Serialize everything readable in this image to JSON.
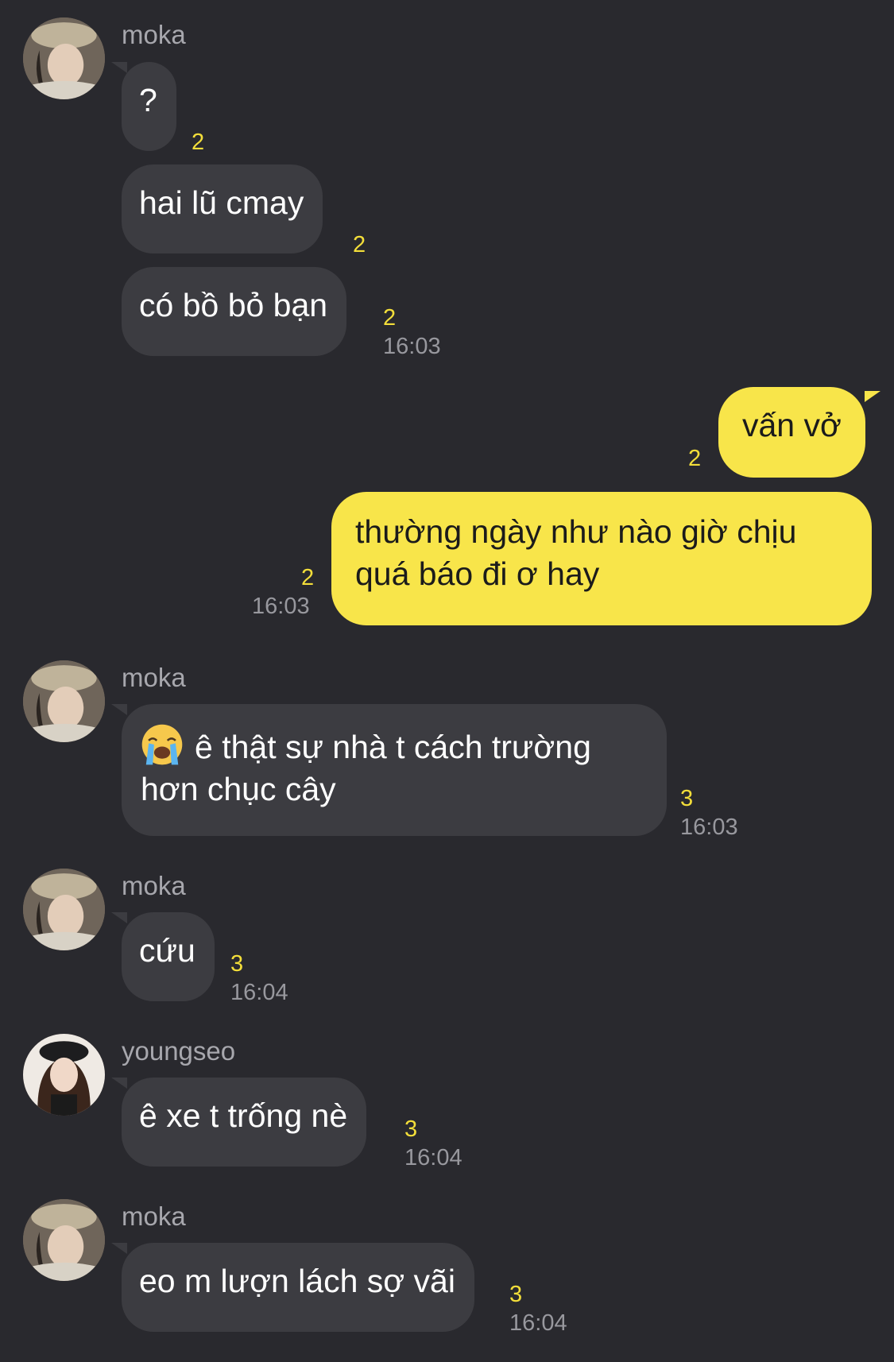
{
  "senders": {
    "moka": "moka",
    "youngseo": "youngseo"
  },
  "messages": [
    {
      "id": "m1",
      "text": "?",
      "read_count": "2"
    },
    {
      "id": "m2",
      "text": "hai lũ cmay",
      "read_count": "2"
    },
    {
      "id": "m3",
      "text": "có bồ bỏ bạn",
      "read_count": "2",
      "time": "16:03"
    },
    {
      "id": "m4",
      "text": "vấn vở",
      "read_count": "2"
    },
    {
      "id": "m5",
      "text": "thường ngày như nào giờ chịu quá báo đi ơ hay",
      "read_count": "2",
      "time": "16:03"
    },
    {
      "id": "m6",
      "text": "ê thật sự nhà t cách trường hơn chục cây",
      "emoji": "loudly-crying-face-icon",
      "read_count": "3",
      "time": "16:03"
    },
    {
      "id": "m7",
      "text": "cứu",
      "read_count": "3",
      "time": "16:04"
    },
    {
      "id": "m8",
      "text": "ê xe t trống nè",
      "read_count": "3",
      "time": "16:04"
    },
    {
      "id": "m9",
      "text": "eo m lượn lách sợ vãi",
      "read_count": "3",
      "time": "16:04"
    }
  ],
  "colors": {
    "background": "#29292e",
    "incoming_bubble": "#3c3c41",
    "outgoing_bubble": "#f8e54a",
    "read_count": "#f3de3a",
    "timestamp": "#98989e"
  }
}
